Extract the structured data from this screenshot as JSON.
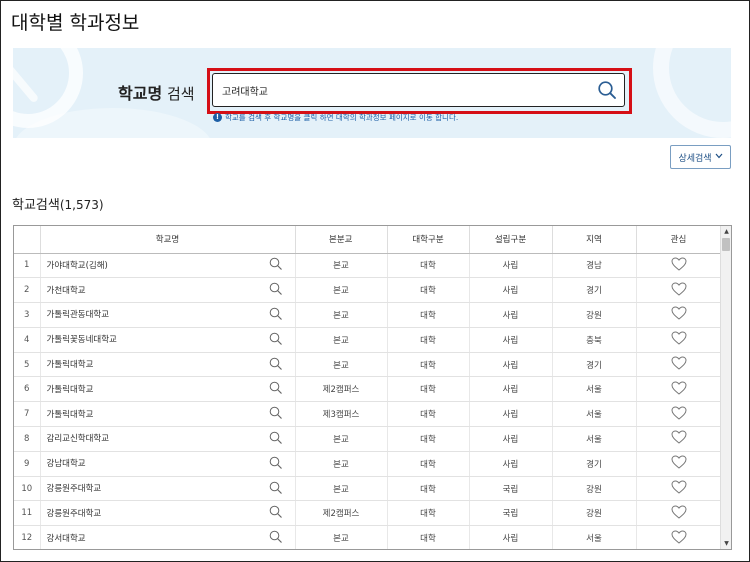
{
  "page": {
    "title": "대학별 학과정보"
  },
  "search": {
    "label_bold": "학교명",
    "label_rest": " 검색",
    "value": "고려대학교",
    "hint": "학교를 검색 후 학교명을 클릭 하면 대학의 학과정보 페이지로 이동 합니다."
  },
  "detail_button": {
    "label": "상세검색",
    "icon": "chevron-down-icon"
  },
  "results": {
    "title": "학교검색",
    "count": "(1,573)"
  },
  "table": {
    "columns": [
      "",
      "학교명",
      "",
      "본분교",
      "대학구분",
      "설립구분",
      "지역",
      "관심"
    ],
    "rows": [
      {
        "no": "1",
        "name": "가야대학교(김해)",
        "campus": "본교",
        "type": "대학",
        "found": "사립",
        "region": "경남"
      },
      {
        "no": "2",
        "name": "가천대학교",
        "campus": "본교",
        "type": "대학",
        "found": "사립",
        "region": "경기"
      },
      {
        "no": "3",
        "name": "가톨릭관동대학교",
        "campus": "본교",
        "type": "대학",
        "found": "사립",
        "region": "강원"
      },
      {
        "no": "4",
        "name": "가톨릭꽃동네대학교",
        "campus": "본교",
        "type": "대학",
        "found": "사립",
        "region": "충북"
      },
      {
        "no": "5",
        "name": "가톨릭대학교",
        "campus": "본교",
        "type": "대학",
        "found": "사립",
        "region": "경기"
      },
      {
        "no": "6",
        "name": "가톨릭대학교",
        "campus": "제2캠퍼스",
        "type": "대학",
        "found": "사립",
        "region": "서울"
      },
      {
        "no": "7",
        "name": "가톨릭대학교",
        "campus": "제3캠퍼스",
        "type": "대학",
        "found": "사립",
        "region": "서울"
      },
      {
        "no": "8",
        "name": "감리교신학대학교",
        "campus": "본교",
        "type": "대학",
        "found": "사립",
        "region": "서울"
      },
      {
        "no": "9",
        "name": "강남대학교",
        "campus": "본교",
        "type": "대학",
        "found": "사립",
        "region": "경기"
      },
      {
        "no": "10",
        "name": "강릉원주대학교",
        "campus": "본교",
        "type": "대학",
        "found": "국립",
        "region": "강원"
      },
      {
        "no": "11",
        "name": "강릉원주대학교",
        "campus": "제2캠퍼스",
        "type": "대학",
        "found": "국립",
        "region": "강원"
      },
      {
        "no": "12",
        "name": "강서대학교",
        "campus": "본교",
        "type": "대학",
        "found": "사립",
        "region": "서울"
      }
    ]
  },
  "colors": {
    "highlight": "#d50f16",
    "banner": "#e4f1f9",
    "hint": "#1d5fa6"
  }
}
